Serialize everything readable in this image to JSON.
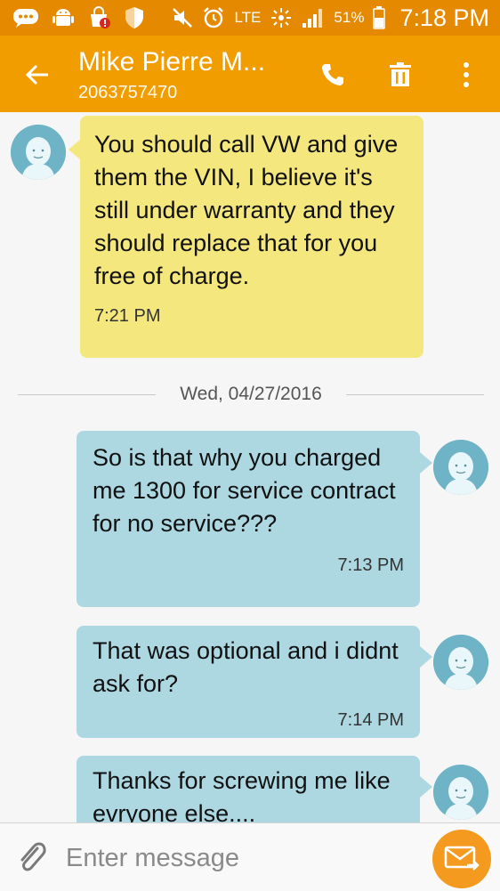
{
  "status_bar": {
    "network": "LTE",
    "battery": "51%",
    "time": "7:18 PM",
    "icons": [
      "chat-notification-icon",
      "android-debug-icon",
      "shopping-bag-icon",
      "shield-icon",
      "mute-icon",
      "alarm-icon",
      "lte-data-icon",
      "signal-icon",
      "battery-icon"
    ]
  },
  "header": {
    "title": "Mike Pierre M...",
    "phone": "2063757470"
  },
  "messages": [
    {
      "direction": "incoming",
      "text": "You should call VW and give them the VIN,  I believe it's still under warranty and they should replace that for you free of charge.",
      "time": "7:21 PM"
    },
    {
      "direction": "outgoing",
      "text": "So is that why you charged me 1300 for service contract for no service???",
      "time": "7:13 PM"
    },
    {
      "direction": "outgoing",
      "text": "That was optional and i didnt ask for?",
      "time": "7:14 PM"
    },
    {
      "direction": "outgoing",
      "text": "Thanks for screwing me like evryone else....",
      "time": ""
    }
  ],
  "date_divider": "Wed, 04/27/2016",
  "composer": {
    "placeholder": "Enter message"
  },
  "colors": {
    "status_bar": "#e58a00",
    "app_bar": "#f19d00",
    "incoming_bubble": "#f4e77e",
    "outgoing_bubble": "#add8e2",
    "avatar": "#6fb3c6",
    "send_button": "#f39a1f"
  }
}
